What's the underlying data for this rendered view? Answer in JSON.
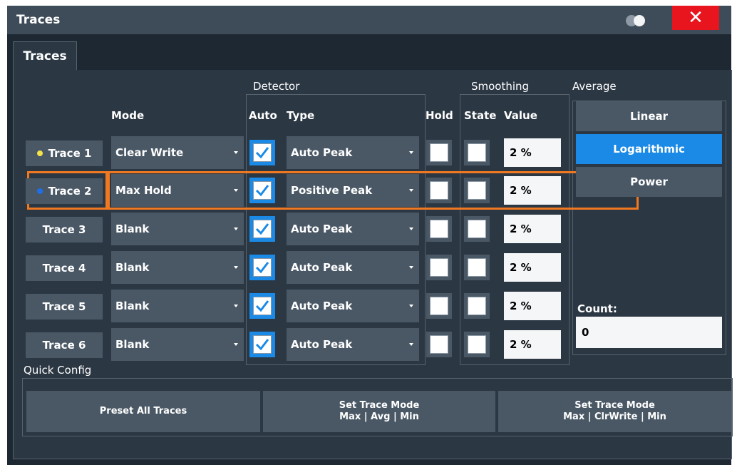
{
  "window": {
    "title": "Traces",
    "close_symbol": "✕"
  },
  "tabs": [
    {
      "label": "Traces",
      "active": true
    }
  ],
  "headers": {
    "detector": "Detector",
    "smoothing": "Smoothing",
    "average": "Average",
    "mode": "Mode",
    "auto": "Auto",
    "type": "Type",
    "hold": "Hold",
    "state": "State",
    "value": "Value"
  },
  "traces": [
    {
      "label": "Trace 1",
      "mode": "Clear Write",
      "auto": true,
      "type": "Auto Peak",
      "hold": false,
      "state": false,
      "value": "2 %",
      "dot_color": "#f5e24a",
      "highlighted": false
    },
    {
      "label": "Trace 2",
      "mode": "Max Hold",
      "auto": true,
      "type": "Positive Peak",
      "hold": false,
      "state": false,
      "value": "2 %",
      "dot_color": "#1e6ee8",
      "highlighted": true
    },
    {
      "label": "Trace 3",
      "mode": "Blank",
      "auto": true,
      "type": "Auto Peak",
      "hold": false,
      "state": false,
      "value": "2 %",
      "dot_color": null,
      "highlighted": false
    },
    {
      "label": "Trace 4",
      "mode": "Blank",
      "auto": true,
      "type": "Auto Peak",
      "hold": false,
      "state": false,
      "value": "2 %",
      "dot_color": null,
      "highlighted": false
    },
    {
      "label": "Trace 5",
      "mode": "Blank",
      "auto": true,
      "type": "Auto Peak",
      "hold": false,
      "state": false,
      "value": "2 %",
      "dot_color": null,
      "highlighted": false
    },
    {
      "label": "Trace 6",
      "mode": "Blank",
      "auto": true,
      "type": "Auto Peak",
      "hold": false,
      "state": false,
      "value": "2 %",
      "dot_color": null,
      "highlighted": false
    }
  ],
  "average": {
    "options": [
      "Linear",
      "Logarithmic",
      "Power"
    ],
    "selected": "Logarithmic",
    "count_label": "Count:",
    "count_value": "0"
  },
  "quick_config": {
    "label": "Quick Config",
    "buttons": [
      {
        "line1": "Preset All Traces",
        "line2": ""
      },
      {
        "line1": "Set Trace Mode",
        "line2": "Max | Avg | Min"
      },
      {
        "line1": "Set Trace Mode",
        "line2": "Max | ClrWrite | Min"
      }
    ]
  },
  "colors": {
    "accent_blue": "#1a8ae6",
    "highlight_orange": "#f07820",
    "close_red": "#e8141e"
  }
}
